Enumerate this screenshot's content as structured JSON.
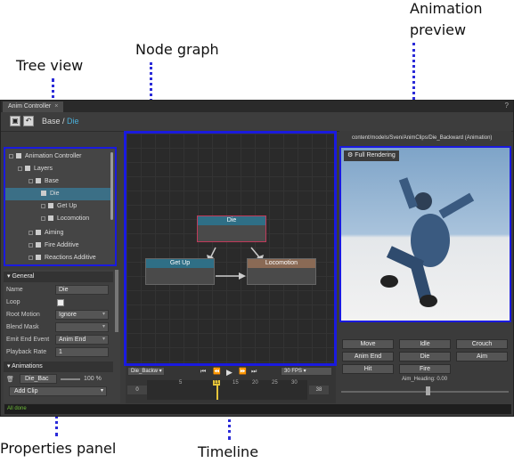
{
  "callouts": {
    "tree_view": "Tree view",
    "node_graph": "Node graph",
    "animation_preview_line1": "Animation",
    "animation_preview_line2": "preview",
    "properties_panel": "Properties panel",
    "timeline": "Timeline"
  },
  "window": {
    "tab_label": "Anim Controller",
    "tab_close": "×",
    "help": "?"
  },
  "toolbar": {
    "save_icon": "save-icon",
    "undo_icon": "undo-icon",
    "breadcrumb_base": "Base",
    "breadcrumb_sep": " / ",
    "breadcrumb_current": "Die"
  },
  "tree": {
    "items": [
      {
        "label": "Animation Controller"
      },
      {
        "label": "Layers"
      },
      {
        "label": "Base"
      },
      {
        "label": "Die"
      },
      {
        "label": "Get Up"
      },
      {
        "label": "Locomotion"
      },
      {
        "label": "Aiming"
      },
      {
        "label": "Fire Additive"
      },
      {
        "label": "Reactions Additive"
      }
    ]
  },
  "properties": {
    "general_header": "General",
    "name_label": "Name",
    "name_value": "Die",
    "loop_label": "Loop",
    "root_motion_label": "Root Motion",
    "root_motion_value": "Ignore",
    "blend_mask_label": "Blend Mask",
    "blend_mask_value": "",
    "emit_end_event_label": "Emit End Event",
    "emit_end_event_value": "Anim End",
    "playback_rate_label": "Playback Rate",
    "playback_rate_value": "1",
    "animations_header": "Animations",
    "anim_clip_value": "Die_Bac",
    "anim_weight": "100 %",
    "add_clip_label": "Add Clip"
  },
  "graph": {
    "nodes": [
      {
        "label": "Die",
        "color": "#2f6f86"
      },
      {
        "label": "Get Up",
        "color": "#2f6f86"
      },
      {
        "label": "Locomotion",
        "color": "#8a6a55"
      }
    ]
  },
  "timeline": {
    "clip_select": "Die_Backw",
    "fps_select": "30 FPS",
    "ticks": [
      "5",
      "15",
      "20",
      "25",
      "30"
    ],
    "playhead_label": "11",
    "start_frame": "0",
    "end_frame": "38"
  },
  "preview": {
    "path": "content/models/Sven/AnimClips/Die_Backward (Animation)",
    "full_rendering_label": "Full Rendering",
    "buttons": [
      "Move",
      "Idle",
      "Crouch",
      "Anim End",
      "Die",
      "Aim",
      "Hit",
      "Fire"
    ],
    "param_label": "Aim_Heading: 0.00"
  },
  "status": {
    "text": "All done"
  },
  "colors": {
    "highlight_border": "#1a1adf",
    "selection": "#3b6f86",
    "accent_text": "#4aaed8",
    "playhead": "#e6c53a"
  }
}
